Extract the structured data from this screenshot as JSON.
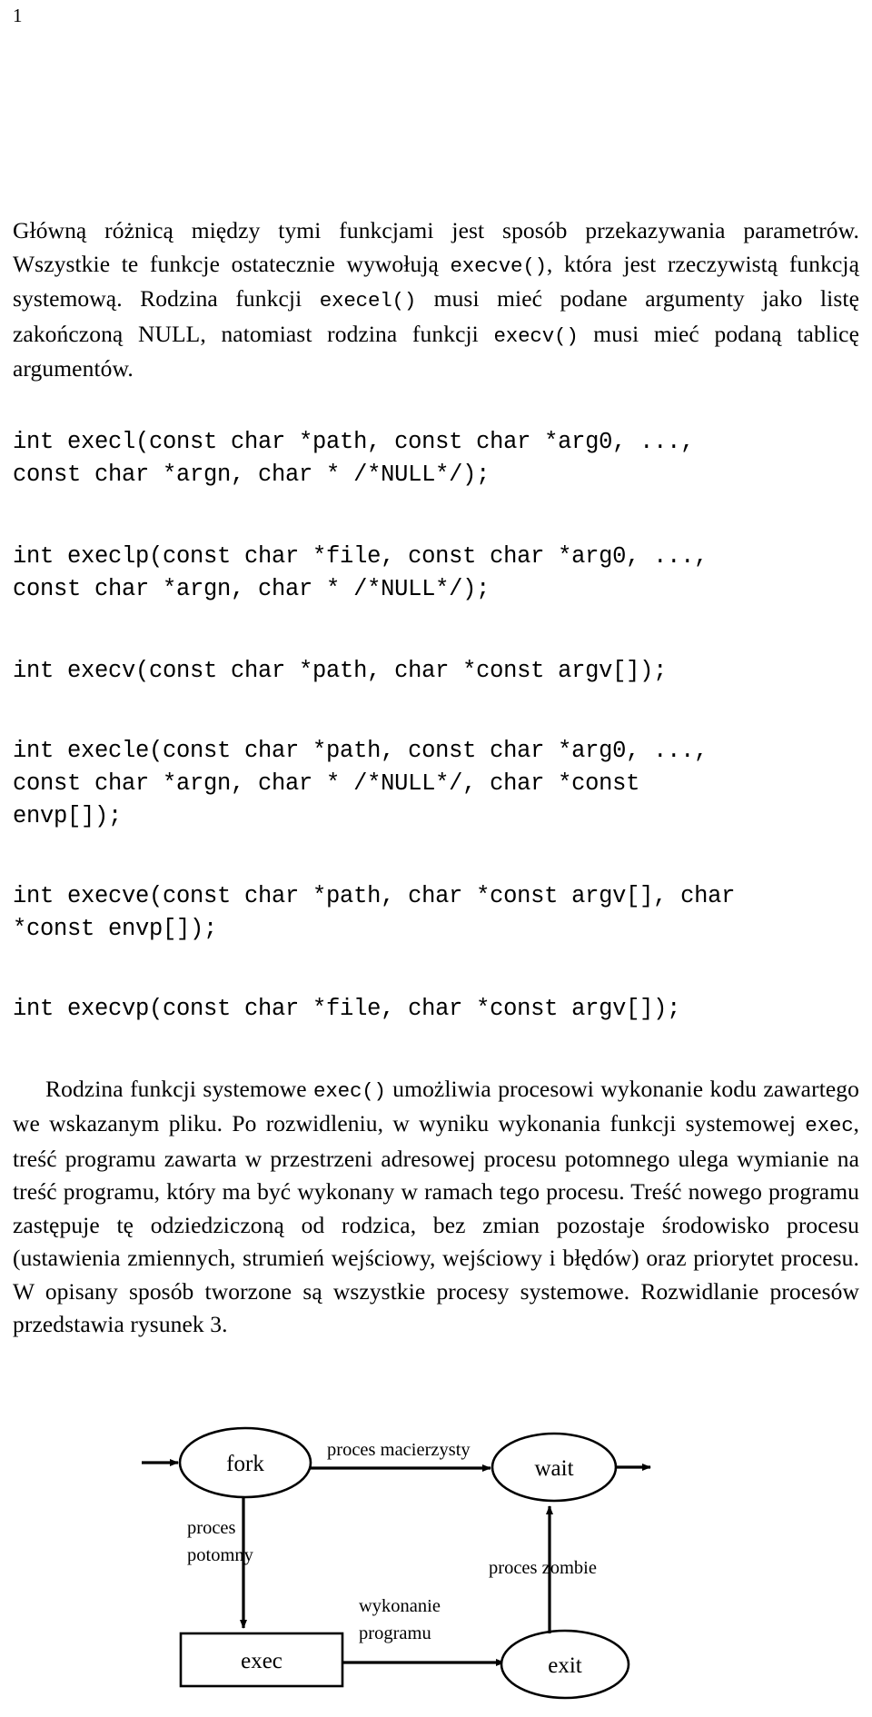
{
  "document": {
    "page_number": "1",
    "language": "pl"
  },
  "paragraphs": {
    "intro": {
      "segments": [
        {
          "type": "text",
          "value": "Główną różnicą między tymi funkcjami jest sposób przekazywania parametrów. Wszystkie te funkcje ostatecznie wywołują "
        },
        {
          "type": "code",
          "value": "execve()"
        },
        {
          "type": "text",
          "value": ", która jest rzeczywistą funkcją systemową. Rodzina funkcji "
        },
        {
          "type": "code",
          "value": "execel()"
        },
        {
          "type": "text",
          "value": " musi mieć podane argumenty jako listę zakończoną NULL, natomiast rodzina funkcji "
        },
        {
          "type": "code",
          "value": "execv()"
        },
        {
          "type": "text",
          "value": " musi mieć podaną tablicę argumentów."
        }
      ]
    },
    "description": {
      "segments": [
        {
          "type": "text",
          "value": "Rodzina funkcji systemowe "
        },
        {
          "type": "code",
          "value": "exec()"
        },
        {
          "type": "text",
          "value": " umożliwia procesowi wykonanie kodu zawartego we wskazanym pliku. Po rozwidleniu, w wyniku wykonania funkcji systemowej "
        },
        {
          "type": "code",
          "value": "exec"
        },
        {
          "type": "text",
          "value": ", treść programu zawarta w przestrzeni adresowej procesu potomnego ulega wymianie na treść programu, który ma być wykonany w ramach tego procesu. Treść nowego programu zastępuje tę odziedziczoną od rodzica, bez zmian pozostaje środowisko procesu (ustawienia zmiennych, strumień wejściowy, wejściowy i błędów) oraz priorytet procesu. W opisany sposób tworzone są wszystkie procesy systemowe. Rozwidlanie procesów przedstawia rysunek 3."
        }
      ]
    }
  },
  "code_blocks": [
    {
      "id": "execl",
      "text": "int execl(const char *path, const char *arg0, ...,\nconst char *argn, char * /*NULL*/);"
    },
    {
      "id": "execlp",
      "text": "int execlp(const char *file, const char *arg0, ...,\nconst char *argn, char * /*NULL*/);"
    },
    {
      "id": "execv",
      "text": "int execv(const char *path, char *const argv[]);"
    },
    {
      "id": "execle",
      "text": "int execle(const char *path, const char *arg0, ...,\nconst char *argn, char * /*NULL*/, char *const\nenvp[]);"
    },
    {
      "id": "execve",
      "text": "int execve(const char *path, char *const argv[], char\n*const envp[]);"
    },
    {
      "id": "execvp",
      "text": "int execvp(const char *file, char *const argv[]);"
    }
  ],
  "diagram": {
    "type": "process-flow",
    "nodes": [
      {
        "id": "fork",
        "label": "fork",
        "shape": "ellipse"
      },
      {
        "id": "wait",
        "label": "wait",
        "shape": "ellipse"
      },
      {
        "id": "exec",
        "label": "exec",
        "shape": "rectangle"
      },
      {
        "id": "exit",
        "label": "exit",
        "shape": "ellipse"
      }
    ],
    "edges": [
      {
        "from": "start",
        "to": "fork",
        "label": ""
      },
      {
        "from": "fork",
        "to": "wait",
        "label": "proces macierzysty"
      },
      {
        "from": "fork",
        "to": "exec",
        "label": "proces\npotomny",
        "label_line1": "proces",
        "label_line2": "potomny"
      },
      {
        "from": "exec",
        "to": "exit",
        "label": "wykonanie\nprogramu",
        "label_line1": "wykonanie",
        "label_line2": "programu"
      },
      {
        "from": "exit",
        "to": "wait",
        "label": "proces zombie"
      },
      {
        "from": "wait",
        "to": "end",
        "label": ""
      }
    ]
  },
  "colors": {
    "text": "#000000",
    "background": "#ffffff",
    "stroke": "#000000"
  }
}
